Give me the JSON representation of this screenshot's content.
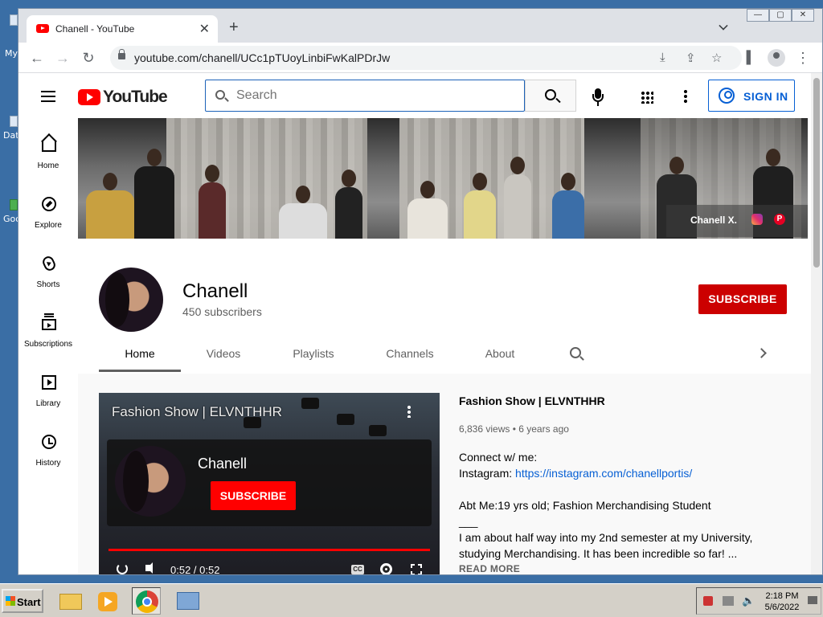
{
  "desktop": {
    "icons": [
      {
        "label": "My"
      },
      {
        "label": "Dat"
      },
      {
        "label": "Goo"
      }
    ]
  },
  "browser": {
    "tab_title": "YouTube",
    "tab_full_title": "Chanell - YouTube",
    "new_tab": "+",
    "url": "youtube.com/chanell/UCc1pTUoyLinbiFwKalPDrJw"
  },
  "masthead": {
    "logo_text": "YouTube",
    "search_placeholder": "Search",
    "sign_in": "SIGN IN"
  },
  "guide": {
    "items": [
      {
        "label": "Home"
      },
      {
        "label": "Explore"
      },
      {
        "label": "Shorts"
      },
      {
        "label": "Subscriptions"
      },
      {
        "label": "Library"
      },
      {
        "label": "History"
      }
    ]
  },
  "banner": {
    "overlay_name": "Chanell X."
  },
  "channel": {
    "name": "Chanell",
    "subscribers": "450 subscribers",
    "subscribe": "SUBSCRIBE",
    "tabs": [
      "Home",
      "Videos",
      "Playlists",
      "Channels",
      "About"
    ],
    "active_tab": "Home"
  },
  "player": {
    "title": "Fashion Show | ELVNTHHR",
    "endcard_name": "Chanell",
    "endcard_subscribe": "SUBSCRIBE",
    "time": "0:52 / 0:52",
    "progress": 1.0,
    "cc_label": "CC"
  },
  "video": {
    "title": "Fashion Show | ELVNTHHR",
    "meta": "6,836 views • 6 years ago",
    "connect": "Connect w/ me:",
    "instagram_label": "Instagram: ",
    "instagram_url": "https://instagram.com/chanellportis/",
    "about": "Abt Me:19 yrs old; Fashion Merchandising Student",
    "separator": "___",
    "line1": "I am about half way into my 2nd semester at my University,",
    "line2": "studying Merchandising. It has been incredible so far! ...",
    "read_more": "READ MORE"
  },
  "taskbar": {
    "start": "Start",
    "time": "2:18 PM",
    "date": "5/6/2022"
  },
  "colors": {
    "youtube_red": "#ff0000",
    "subscribe_red": "#cc0000",
    "link_blue": "#065fd4"
  }
}
